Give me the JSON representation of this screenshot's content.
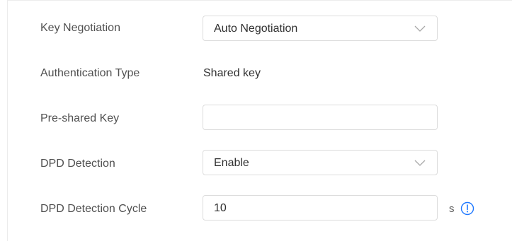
{
  "form": {
    "key_negotiation": {
      "label": "Key Negotiation",
      "selected": "Auto Negotiation",
      "icon": "chevron-down-icon"
    },
    "authentication_type": {
      "label": "Authentication Type",
      "value": "Shared key"
    },
    "pre_shared_key": {
      "label": "Pre-shared Key",
      "value": ""
    },
    "dpd_detection": {
      "label": "DPD Detection",
      "selected": "Enable",
      "icon": "chevron-down-icon"
    },
    "dpd_detection_cycle": {
      "label": "DPD Detection Cycle",
      "value": "10",
      "unit": "s",
      "info_icon": "info-circle-icon"
    }
  },
  "colors": {
    "label": "#505050",
    "text": "#303030",
    "border": "#dcdcdc",
    "accent": "#1e78ff"
  }
}
